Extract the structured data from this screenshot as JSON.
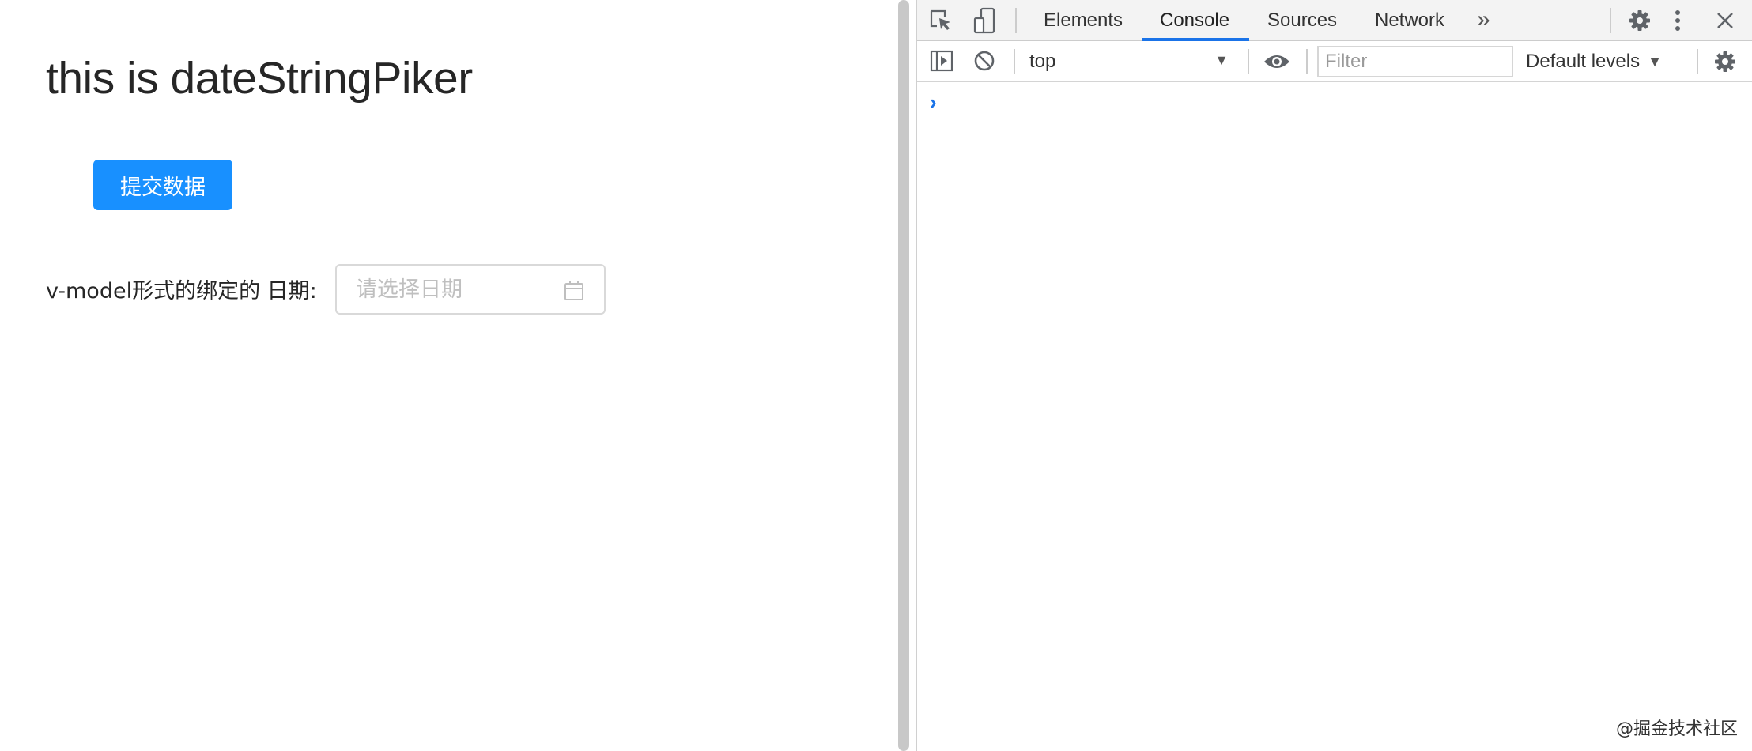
{
  "page": {
    "title": "this is dateStringPiker",
    "submit_label": "提交数据",
    "field_label": "v-model形式的绑定的 日期:",
    "date_input": {
      "value": "",
      "placeholder": "请选择日期"
    },
    "accent_color": "#1890ff"
  },
  "devtools": {
    "tabs": [
      "Elements",
      "Console",
      "Sources",
      "Network"
    ],
    "active_tab": "Console",
    "more_tabs_glyph": "»",
    "context": "top",
    "filter_placeholder": "Filter",
    "levels": "Default levels",
    "prompt_glyph": "›",
    "icons": [
      "inspect-element-icon",
      "device-toolbar-icon",
      "settings-icon",
      "more-options-icon",
      "close-icon",
      "sidebar-toggle-icon",
      "clear-console-icon",
      "live-expression-eye-icon",
      "console-settings-icon"
    ]
  },
  "watermark": "@掘金技术社区"
}
